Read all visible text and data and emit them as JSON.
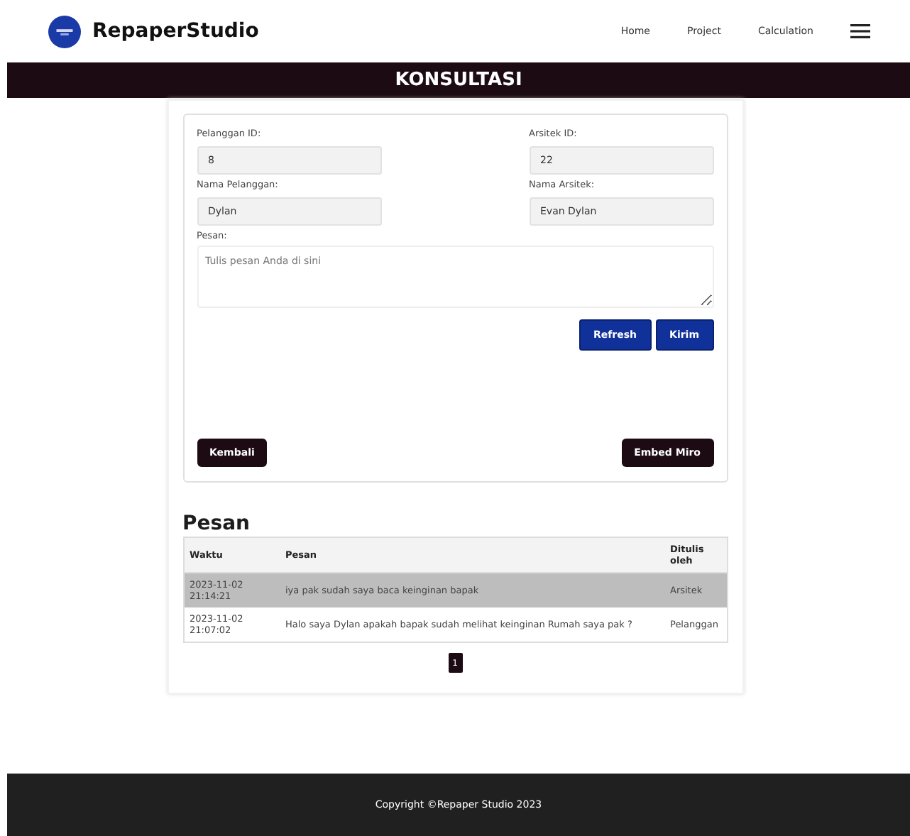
{
  "header": {
    "brand": "RepaperStudio",
    "nav": [
      {
        "label": "Home",
        "selected": false
      },
      {
        "label": "Project",
        "selected": false
      },
      {
        "label": "Calculation",
        "selected": false
      }
    ]
  },
  "banner": {
    "title": "KONSULTASI"
  },
  "form": {
    "fields": [
      {
        "label": "Pelanggan ID:",
        "value": "8"
      },
      {
        "label": "Arsitek ID:",
        "value": "22"
      },
      {
        "label": "Nama Pelanggan:",
        "value": "Dylan"
      },
      {
        "label": "Nama Arsitek:",
        "value": "Evan Dylan"
      }
    ],
    "message": {
      "label": "Pesan:",
      "placeholder": "Tulis pesan Anda di sini"
    },
    "actions": [
      "Refresh",
      "Kirim"
    ],
    "back": "Kembali",
    "embed": "Embed Miro"
  },
  "messages": {
    "title": "Pesan",
    "columns": [
      "Waktu",
      "Pesan",
      "Ditulis oleh"
    ],
    "rows": [
      {
        "time": "2023-11-02 21:14:21",
        "text": "iya pak sudah saya baca keinginan bapak",
        "author": "Arsitek",
        "selected": true
      },
      {
        "time": "2023-11-02 21:07:02",
        "text": "Halo saya Dylan apakah bapak sudah melihat keinginan Rumah saya pak ?",
        "author": "Pelanggan",
        "selected": false
      }
    ],
    "pages": [
      {
        "label": "1",
        "selected": true
      }
    ]
  },
  "footer": {
    "text": "Copyright ©Repaper Studio 2023"
  }
}
